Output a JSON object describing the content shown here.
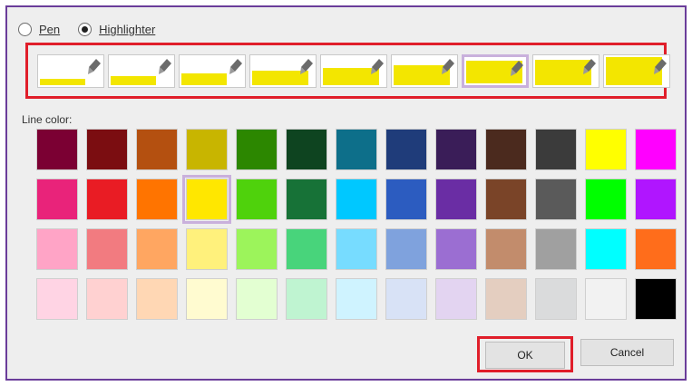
{
  "mode": {
    "options": [
      {
        "label": "Pen",
        "checked": false
      },
      {
        "label": "Highlighter",
        "checked": true
      }
    ]
  },
  "thickness": {
    "options": [
      {
        "level": 1,
        "selected": false
      },
      {
        "level": 2,
        "selected": false
      },
      {
        "level": 3,
        "selected": false
      },
      {
        "level": 4,
        "selected": false
      },
      {
        "level": 5,
        "selected": false
      },
      {
        "level": 6,
        "selected": false
      },
      {
        "level": 7,
        "selected": true
      },
      {
        "level": 8,
        "selected": false
      },
      {
        "level": 9,
        "selected": false
      }
    ],
    "highlight_color": "#f3e600"
  },
  "line_color": {
    "label": "Line color:",
    "selected": "#ffe700",
    "rows": [
      [
        "#7b0033",
        "#7b0d11",
        "#b45010",
        "#c8b500",
        "#2c8700",
        "#0e4420",
        "#0d6f8a",
        "#1f3c7a",
        "#3a1d58",
        "#4b2a1e",
        "#3b3b3b",
        "#ffff00",
        "#ff00ff"
      ],
      [
        "#e9237a",
        "#e91c24",
        "#ff7400",
        "#ffe700",
        "#4fd20c",
        "#177237",
        "#00c8ff",
        "#2c5cc0",
        "#6a2da4",
        "#7a4428",
        "#5a5a5a",
        "#00ff00",
        "#b015ff"
      ],
      [
        "#ffa4c6",
        "#f27b80",
        "#ffa661",
        "#fff17c",
        "#9cf45b",
        "#48d47b",
        "#77dcff",
        "#7fa2dd",
        "#9b6ed2",
        "#c28c6c",
        "#a0a0a0",
        "#00ffff",
        "#ff6d1b"
      ],
      [
        "#ffd4e4",
        "#ffd1d1",
        "#ffd7b4",
        "#fffbd0",
        "#e3ffd2",
        "#bff4d1",
        "#cff3ff",
        "#d8e2f6",
        "#e3d4f1",
        "#e4cec0",
        "#dadbdc",
        "#f2f2f2",
        "#000000"
      ]
    ]
  },
  "buttons": {
    "ok": "OK",
    "cancel": "Cancel"
  }
}
